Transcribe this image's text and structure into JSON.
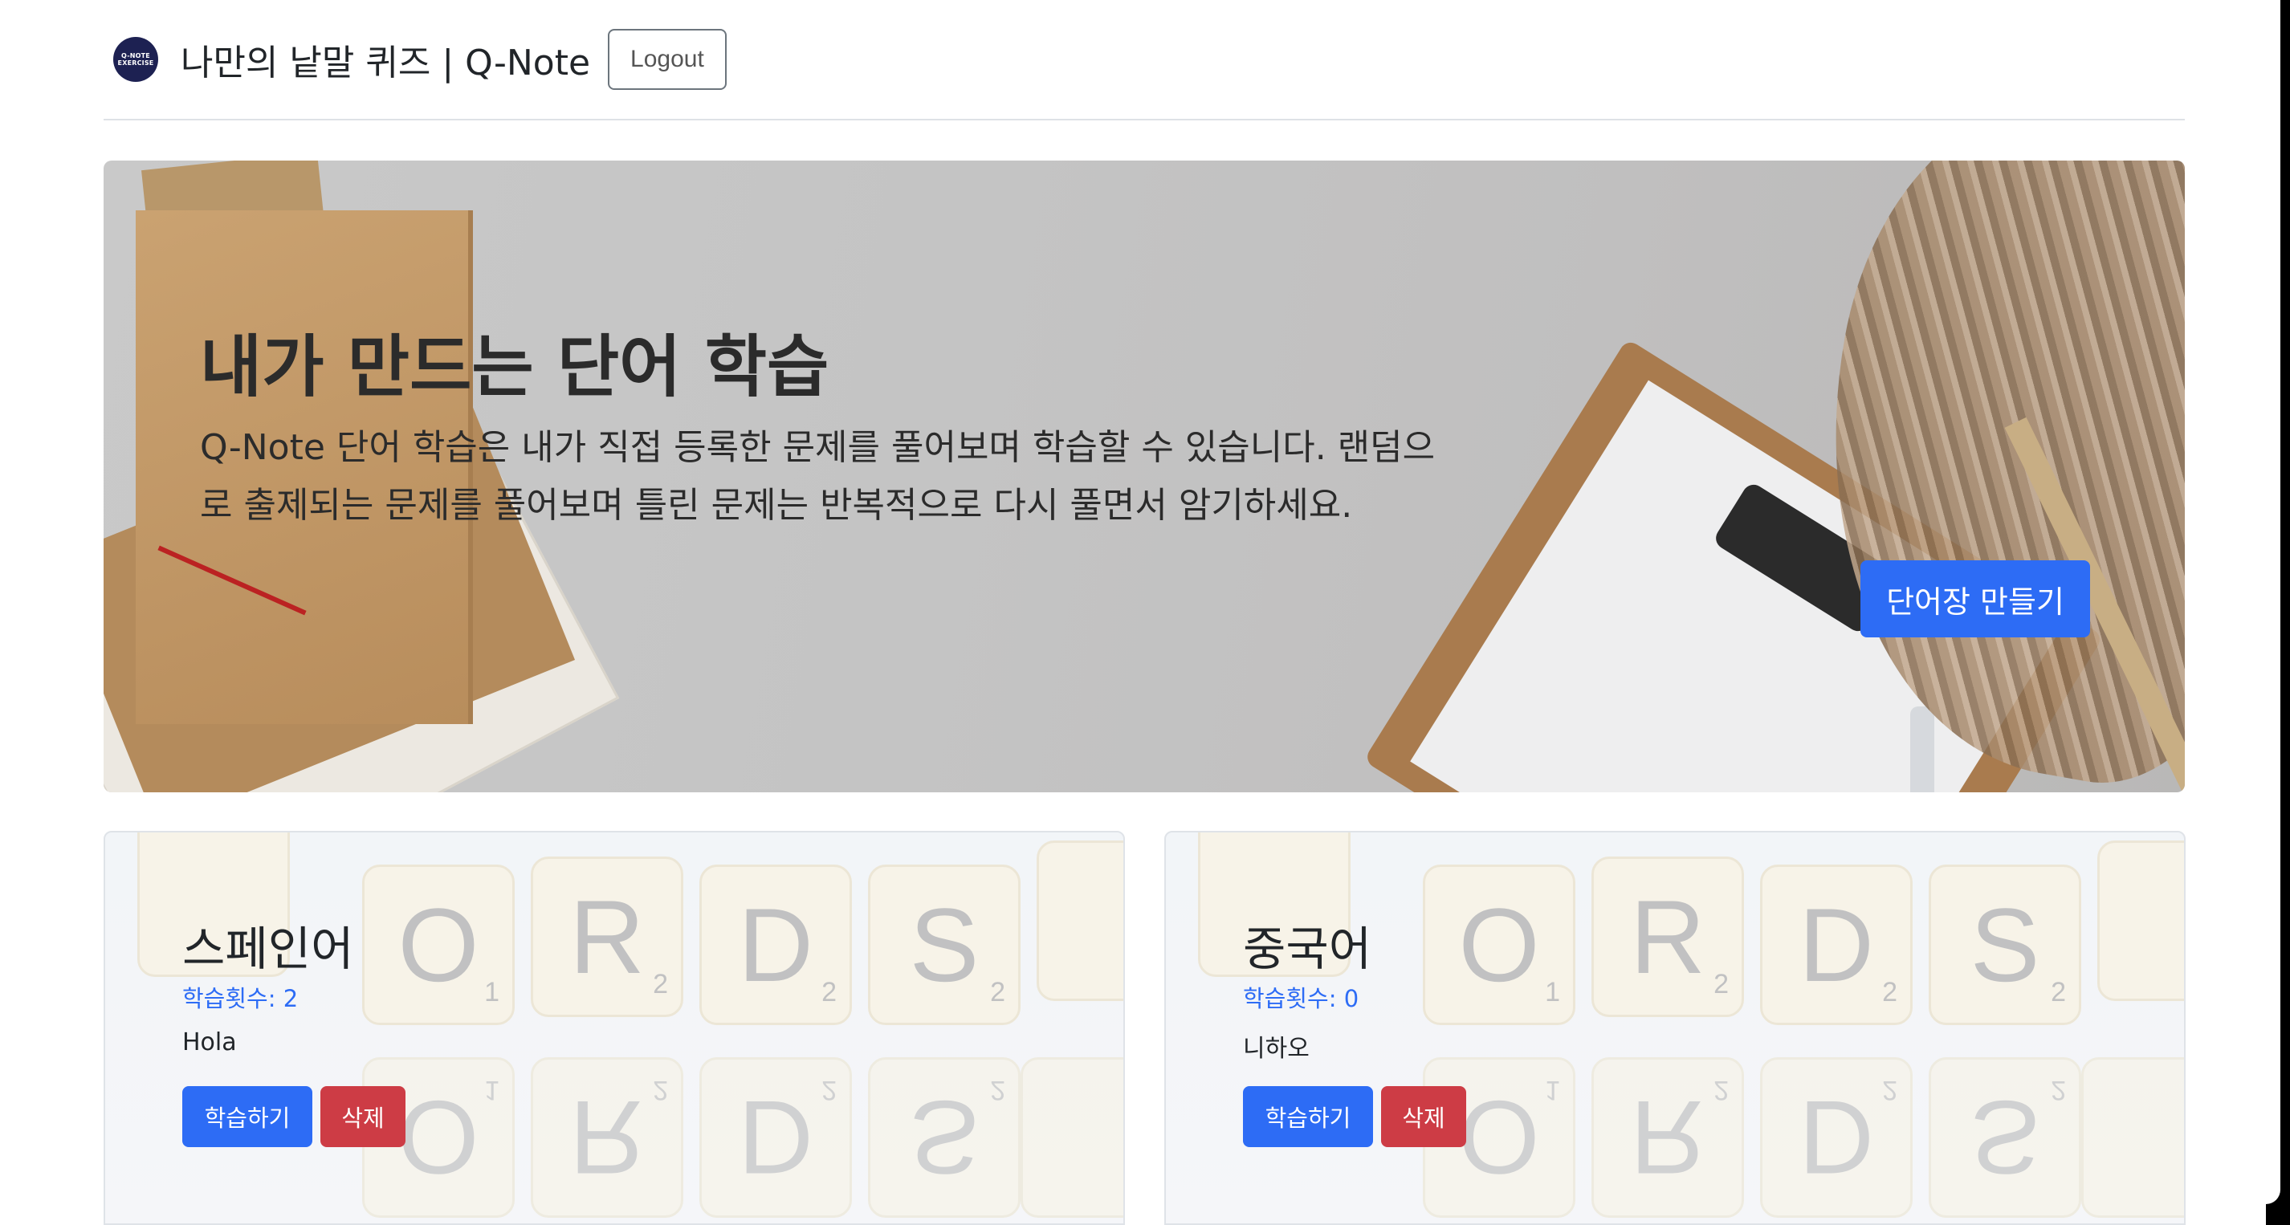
{
  "header": {
    "logo_icon": "q-note-logo",
    "logo_text": [
      "Q-NOTE",
      "EXERCISE"
    ],
    "title": "나만의 낱말 퀴즈 | Q-Note",
    "logout_label": "Logout"
  },
  "hero": {
    "title": "내가 만드는 단어 학습",
    "description": "Q-Note 단어 학습은 내가 직접 등록한 문제를 풀어보며 학습할 수 있습니다. 랜덤으로 출제되는 문제를 풀어보며 틀린 문제는 반복적으로 다시 풀면서 암기하세요.",
    "create_button_label": "단어장 만들기"
  },
  "wordbooks": [
    {
      "title": "스페인어",
      "study_count_label": "학습횟수: ",
      "study_count": "2",
      "word": "Hola",
      "study_button_label": "학습하기",
      "delete_button_label": "삭제"
    },
    {
      "title": "중국어",
      "study_count_label": "학습횟수: ",
      "study_count": "0",
      "word": "니하오",
      "study_button_label": "학습하기",
      "delete_button_label": "삭제"
    }
  ],
  "colors": {
    "primary": "#2d6cf5",
    "danger": "#cd3c45",
    "logo_bg": "#1d2152"
  }
}
